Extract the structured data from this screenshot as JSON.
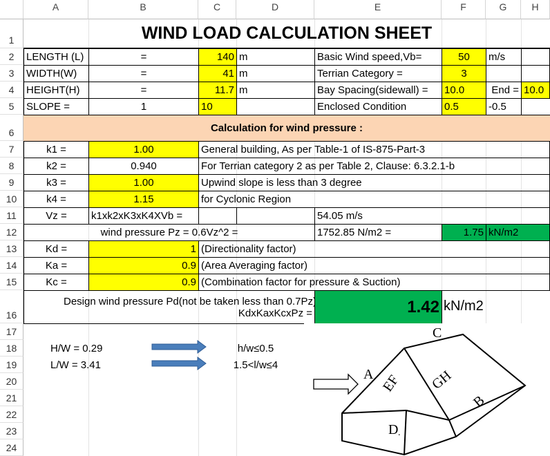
{
  "columns": [
    "A",
    "B",
    "C",
    "D",
    "E",
    "F",
    "G",
    "H"
  ],
  "rows": [
    "1",
    "2",
    "3",
    "4",
    "5",
    "6",
    "7",
    "8",
    "9",
    "10",
    "11",
    "12",
    "13",
    "14",
    "15",
    "16",
    "17",
    "18",
    "19",
    "20",
    "21",
    "22",
    "23",
    "24"
  ],
  "title": "WIND LOAD CALCULATION SHEET",
  "dims": {
    "length_label": "LENGTH (L)",
    "width_label": "WIDTH(W)",
    "height_label": "HEIGHT(H)",
    "slope_label": "SLOPE =",
    "eq": "=",
    "slope_ratio": "1",
    "length_val": "140",
    "width_val": "41",
    "height_val": "11.7",
    "slope_val": "10",
    "unit_m": "m"
  },
  "params": {
    "wind_speed_label": "Basic Wind speed,Vb=",
    "wind_speed_val": "50",
    "wind_speed_unit": "m/s",
    "terrain_label": "Terrian Category =",
    "terrain_val": "3",
    "bay_label": "Bay Spacing(sidewall) =",
    "bay_val": "10.0",
    "end_label": "End =",
    "end_val": "10.0",
    "enclosed_label": "Enclosed Condition",
    "enclosed_pos": "0.5",
    "enclosed_neg": "-0.5"
  },
  "calc_header": "Calculation for wind pressure :",
  "factors": {
    "k1_label": "k1 =",
    "k1_val": "1.00",
    "k1_desc": "General building, As per Table-1 of IS-875-Part-3",
    "k2_label": "k2 =",
    "k2_val": "0.940",
    "k2_desc": "For Terrian category 2 as per Table 2, Clause: 6.3.2.1-b",
    "k3_label": "k3 =",
    "k3_val": "1.00",
    "k3_desc": "Upwind slope is less than 3 degree",
    "k4_label": "k4 =",
    "k4_val": "1.15",
    "k4_desc": "for Cyclonic Region",
    "vz_label": "Vz =",
    "vz_formula": "k1xk2xK3xK4XVb =",
    "vz_val": "54.05  m/s",
    "pz_label": "wind pressure Pz = 0.6Vz^2 =",
    "pz_val": "1752.85 N/m2 =",
    "pz_kn": "1.75",
    "pz_unit": "kN/m2",
    "kd_label": "Kd =",
    "kd_val": "1",
    "kd_desc": "(Directionality factor)",
    "ka_label": "Ka =",
    "ka_val": "0.9",
    "ka_desc": "(Area Averaging factor)",
    "kc_label": "Kc =",
    "kc_val": "0.9",
    "kc_desc": "(Combination factor for pressure & Suction)"
  },
  "design": {
    "label1": "Design wind pressure Pd(not be taken less than 0.7Pz)",
    "label2": "KdxKaxKcxPz =",
    "value": "1.42",
    "unit": "kN/m2"
  },
  "ratios": {
    "hw": "H/W = 0.29",
    "hw_cond": "h/w≤0.5",
    "lw": "L/W = 3.41",
    "lw_cond": "1.5<l/w≤4"
  },
  "diagram": {
    "A": "A",
    "B": "B",
    "C": "C",
    "D": "D",
    "EF": "EF",
    "GH": "GH",
    "dot": "."
  }
}
